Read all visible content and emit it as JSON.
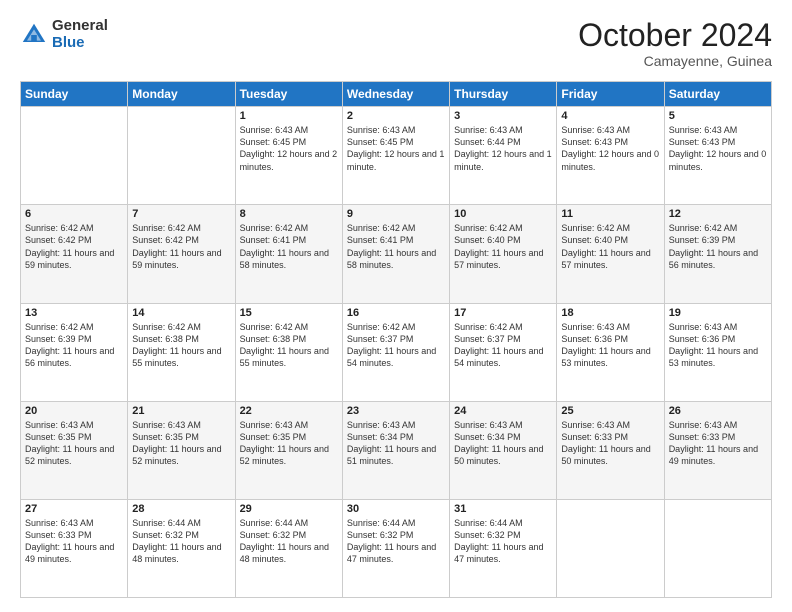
{
  "header": {
    "logo_general": "General",
    "logo_blue": "Blue",
    "month_title": "October 2024",
    "location": "Camayenne, Guinea"
  },
  "days_of_week": [
    "Sunday",
    "Monday",
    "Tuesday",
    "Wednesday",
    "Thursday",
    "Friday",
    "Saturday"
  ],
  "weeks": [
    [
      {
        "day": "",
        "info": ""
      },
      {
        "day": "",
        "info": ""
      },
      {
        "day": "1",
        "info": "Sunrise: 6:43 AM\nSunset: 6:45 PM\nDaylight: 12 hours and 2 minutes."
      },
      {
        "day": "2",
        "info": "Sunrise: 6:43 AM\nSunset: 6:45 PM\nDaylight: 12 hours and 1 minute."
      },
      {
        "day": "3",
        "info": "Sunrise: 6:43 AM\nSunset: 6:44 PM\nDaylight: 12 hours and 1 minute."
      },
      {
        "day": "4",
        "info": "Sunrise: 6:43 AM\nSunset: 6:43 PM\nDaylight: 12 hours and 0 minutes."
      },
      {
        "day": "5",
        "info": "Sunrise: 6:43 AM\nSunset: 6:43 PM\nDaylight: 12 hours and 0 minutes."
      }
    ],
    [
      {
        "day": "6",
        "info": "Sunrise: 6:42 AM\nSunset: 6:42 PM\nDaylight: 11 hours and 59 minutes."
      },
      {
        "day": "7",
        "info": "Sunrise: 6:42 AM\nSunset: 6:42 PM\nDaylight: 11 hours and 59 minutes."
      },
      {
        "day": "8",
        "info": "Sunrise: 6:42 AM\nSunset: 6:41 PM\nDaylight: 11 hours and 58 minutes."
      },
      {
        "day": "9",
        "info": "Sunrise: 6:42 AM\nSunset: 6:41 PM\nDaylight: 11 hours and 58 minutes."
      },
      {
        "day": "10",
        "info": "Sunrise: 6:42 AM\nSunset: 6:40 PM\nDaylight: 11 hours and 57 minutes."
      },
      {
        "day": "11",
        "info": "Sunrise: 6:42 AM\nSunset: 6:40 PM\nDaylight: 11 hours and 57 minutes."
      },
      {
        "day": "12",
        "info": "Sunrise: 6:42 AM\nSunset: 6:39 PM\nDaylight: 11 hours and 56 minutes."
      }
    ],
    [
      {
        "day": "13",
        "info": "Sunrise: 6:42 AM\nSunset: 6:39 PM\nDaylight: 11 hours and 56 minutes."
      },
      {
        "day": "14",
        "info": "Sunrise: 6:42 AM\nSunset: 6:38 PM\nDaylight: 11 hours and 55 minutes."
      },
      {
        "day": "15",
        "info": "Sunrise: 6:42 AM\nSunset: 6:38 PM\nDaylight: 11 hours and 55 minutes."
      },
      {
        "day": "16",
        "info": "Sunrise: 6:42 AM\nSunset: 6:37 PM\nDaylight: 11 hours and 54 minutes."
      },
      {
        "day": "17",
        "info": "Sunrise: 6:42 AM\nSunset: 6:37 PM\nDaylight: 11 hours and 54 minutes."
      },
      {
        "day": "18",
        "info": "Sunrise: 6:43 AM\nSunset: 6:36 PM\nDaylight: 11 hours and 53 minutes."
      },
      {
        "day": "19",
        "info": "Sunrise: 6:43 AM\nSunset: 6:36 PM\nDaylight: 11 hours and 53 minutes."
      }
    ],
    [
      {
        "day": "20",
        "info": "Sunrise: 6:43 AM\nSunset: 6:35 PM\nDaylight: 11 hours and 52 minutes."
      },
      {
        "day": "21",
        "info": "Sunrise: 6:43 AM\nSunset: 6:35 PM\nDaylight: 11 hours and 52 minutes."
      },
      {
        "day": "22",
        "info": "Sunrise: 6:43 AM\nSunset: 6:35 PM\nDaylight: 11 hours and 52 minutes."
      },
      {
        "day": "23",
        "info": "Sunrise: 6:43 AM\nSunset: 6:34 PM\nDaylight: 11 hours and 51 minutes."
      },
      {
        "day": "24",
        "info": "Sunrise: 6:43 AM\nSunset: 6:34 PM\nDaylight: 11 hours and 50 minutes."
      },
      {
        "day": "25",
        "info": "Sunrise: 6:43 AM\nSunset: 6:33 PM\nDaylight: 11 hours and 50 minutes."
      },
      {
        "day": "26",
        "info": "Sunrise: 6:43 AM\nSunset: 6:33 PM\nDaylight: 11 hours and 49 minutes."
      }
    ],
    [
      {
        "day": "27",
        "info": "Sunrise: 6:43 AM\nSunset: 6:33 PM\nDaylight: 11 hours and 49 minutes."
      },
      {
        "day": "28",
        "info": "Sunrise: 6:44 AM\nSunset: 6:32 PM\nDaylight: 11 hours and 48 minutes."
      },
      {
        "day": "29",
        "info": "Sunrise: 6:44 AM\nSunset: 6:32 PM\nDaylight: 11 hours and 48 minutes."
      },
      {
        "day": "30",
        "info": "Sunrise: 6:44 AM\nSunset: 6:32 PM\nDaylight: 11 hours and 47 minutes."
      },
      {
        "day": "31",
        "info": "Sunrise: 6:44 AM\nSunset: 6:32 PM\nDaylight: 11 hours and 47 minutes."
      },
      {
        "day": "",
        "info": ""
      },
      {
        "day": "",
        "info": ""
      }
    ]
  ]
}
